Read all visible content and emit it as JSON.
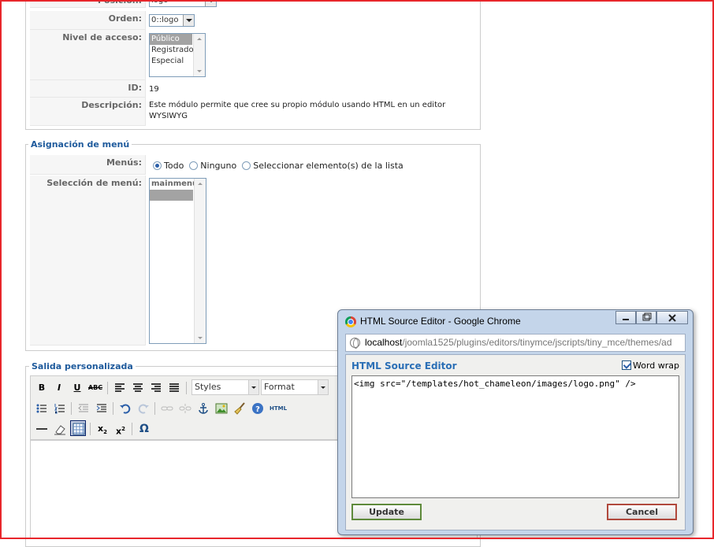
{
  "detalles": {
    "posicion_label": "Posición:",
    "posicion_value": "logo",
    "orden_label": "Orden:",
    "orden_value": "0::logo",
    "acceso_label": "Nivel de acceso:",
    "acceso_options": [
      "Público",
      "Registrado",
      "Especial"
    ],
    "id_label": "ID:",
    "id_value": "19",
    "descripcion_label": "Descripción:",
    "descripcion_value": "Este módulo permite que cree su propio módulo usando HTML en un editor WYSIWYG"
  },
  "asignacion": {
    "legend": "Asignación de menú",
    "menus_label": "Menús:",
    "radio_todo": "Todo",
    "radio_ninguno": "Ninguno",
    "radio_seleccionar": "Seleccionar elemento(s) de la lista",
    "seleccion_label": "Selección de menú:",
    "seleccion_options": [
      "mainmenu",
      ""
    ]
  },
  "salida": {
    "legend": "Salida personalizada",
    "styles_select": "Styles",
    "format_select": "Format",
    "html_button": "HTML"
  },
  "popup": {
    "window_title": "HTML Source Editor - Google Chrome",
    "url_host": "localhost",
    "url_path": "/joomla1525/plugins/editors/tinymce/jscripts/tiny_mce/themes/ad",
    "heading": "HTML Source Editor",
    "word_wrap_label": "Word wrap",
    "word_wrap_checked": true,
    "source_code": "<img src=\"/templates/hot_chameleon/images/logo.png\" />",
    "update_label": "Update",
    "cancel_label": "Cancel"
  },
  "colors": {
    "legend_blue": "#1e5a9c",
    "frame_red": "#e8262b",
    "popup_frame": "#c4d5ea"
  }
}
